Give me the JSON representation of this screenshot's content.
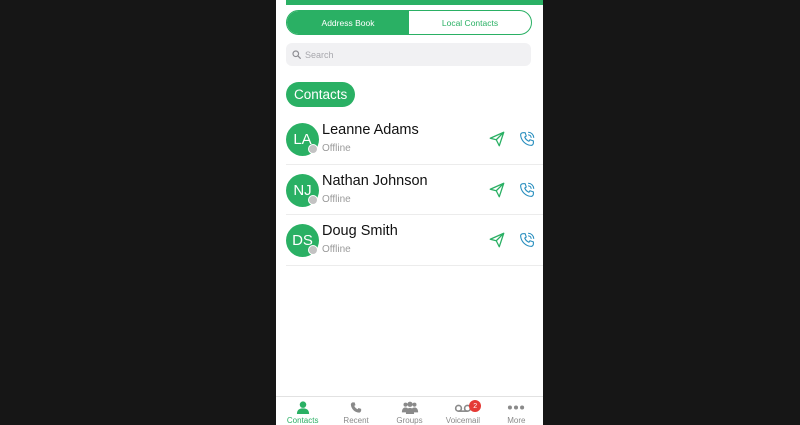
{
  "colors": {
    "accent": "#2ab064",
    "icon_gray": "#8a8a8a",
    "badge_red": "#e53935",
    "presence_offline": "#c2c2c2",
    "backdrop": "#161616"
  },
  "segments": [
    {
      "label": "Address Book",
      "active": true
    },
    {
      "label": "Local Contacts",
      "active": false
    }
  ],
  "search": {
    "placeholder": "Search",
    "value": "",
    "icon": "search-icon"
  },
  "section": {
    "label": "Contacts"
  },
  "contacts": [
    {
      "initials": "LA",
      "name": "Leanne Adams",
      "status": "Offline"
    },
    {
      "initials": "NJ",
      "name": "Nathan Johnson",
      "status": "Offline"
    },
    {
      "initials": "DS",
      "name": "Doug Smith",
      "status": "Offline"
    }
  ],
  "row_actions": {
    "message_icon": "paper-plane-icon",
    "call_icon": "phone-call-icon"
  },
  "tabbar": {
    "tabs": [
      {
        "label": "Contacts",
        "icon": "person-icon",
        "active": true
      },
      {
        "label": "Recent",
        "icon": "phone-icon",
        "active": false
      },
      {
        "label": "Groups",
        "icon": "group-icon",
        "active": false
      },
      {
        "label": "Voicemail",
        "icon": "voicemail-icon",
        "active": false,
        "badge": "2"
      },
      {
        "label": "More",
        "icon": "more-dots-icon",
        "active": false
      }
    ]
  }
}
